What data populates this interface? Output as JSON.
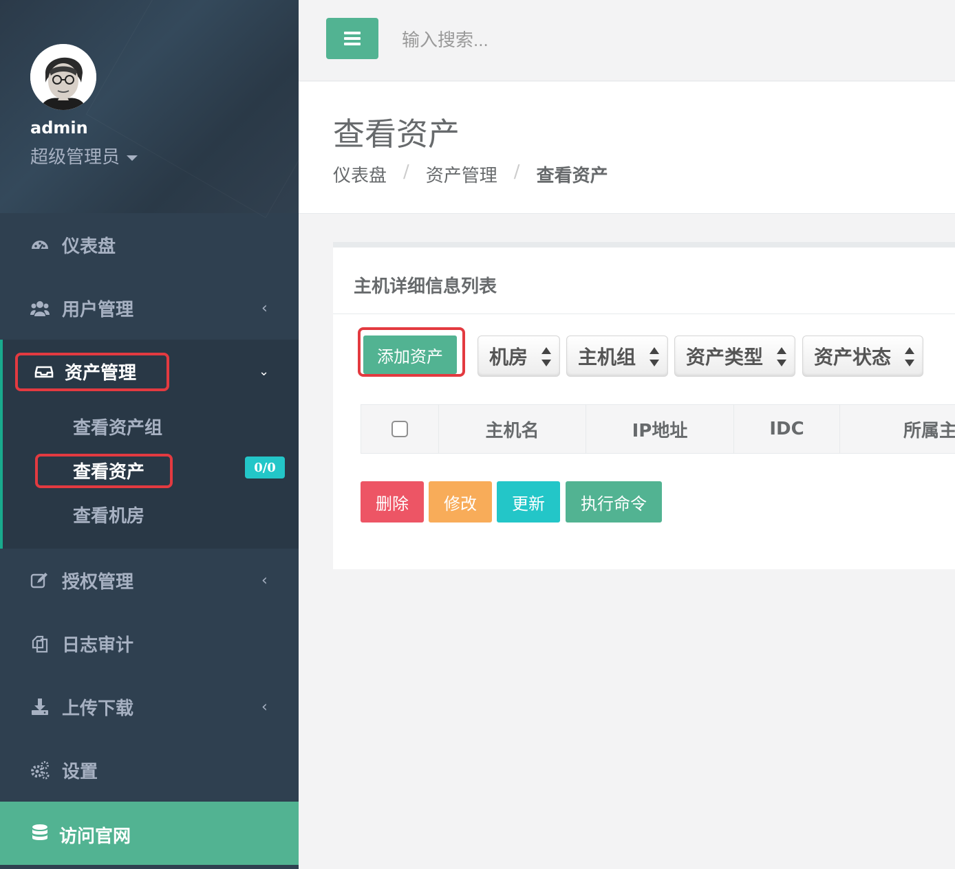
{
  "sidebar": {
    "user": {
      "name": "admin",
      "role": "超级管理员"
    },
    "items": [
      {
        "label": "仪表盘",
        "icon": "dashboard-icon"
      },
      {
        "label": "用户管理",
        "icon": "users-icon"
      },
      {
        "label": "资产管理",
        "icon": "inbox-icon"
      },
      {
        "label": "授权管理",
        "icon": "edit-icon"
      },
      {
        "label": "日志审计",
        "icon": "files-icon"
      },
      {
        "label": "上传下载",
        "icon": "download-icon"
      },
      {
        "label": "设置",
        "icon": "gears-icon"
      },
      {
        "label": "访问官网",
        "icon": "database-icon"
      }
    ],
    "submenu": [
      {
        "label": "查看资产组"
      },
      {
        "label": "查看资产"
      },
      {
        "label": "查看机房"
      }
    ],
    "badge": "0/0"
  },
  "topbar": {
    "search_placeholder": "输入搜索..."
  },
  "page": {
    "title": "查看资产",
    "breadcrumb": [
      "仪表盘",
      "资产管理",
      "查看资产"
    ]
  },
  "panel": {
    "title": "主机详细信息列表",
    "add_button": "添加资产",
    "filters": [
      "机房",
      "主机组",
      "资产类型",
      "资产状态"
    ],
    "columns": [
      "主机名",
      "IP地址",
      "IDC",
      "所属主"
    ],
    "actions": [
      "删除",
      "修改",
      "更新",
      "执行命令"
    ]
  },
  "colors": {
    "sidebar": "#2f4050",
    "accent": "#52b392",
    "danger": "#ed5565",
    "warning": "#f8ac59",
    "info": "#23c6c8",
    "highlight": "#e33a40"
  }
}
